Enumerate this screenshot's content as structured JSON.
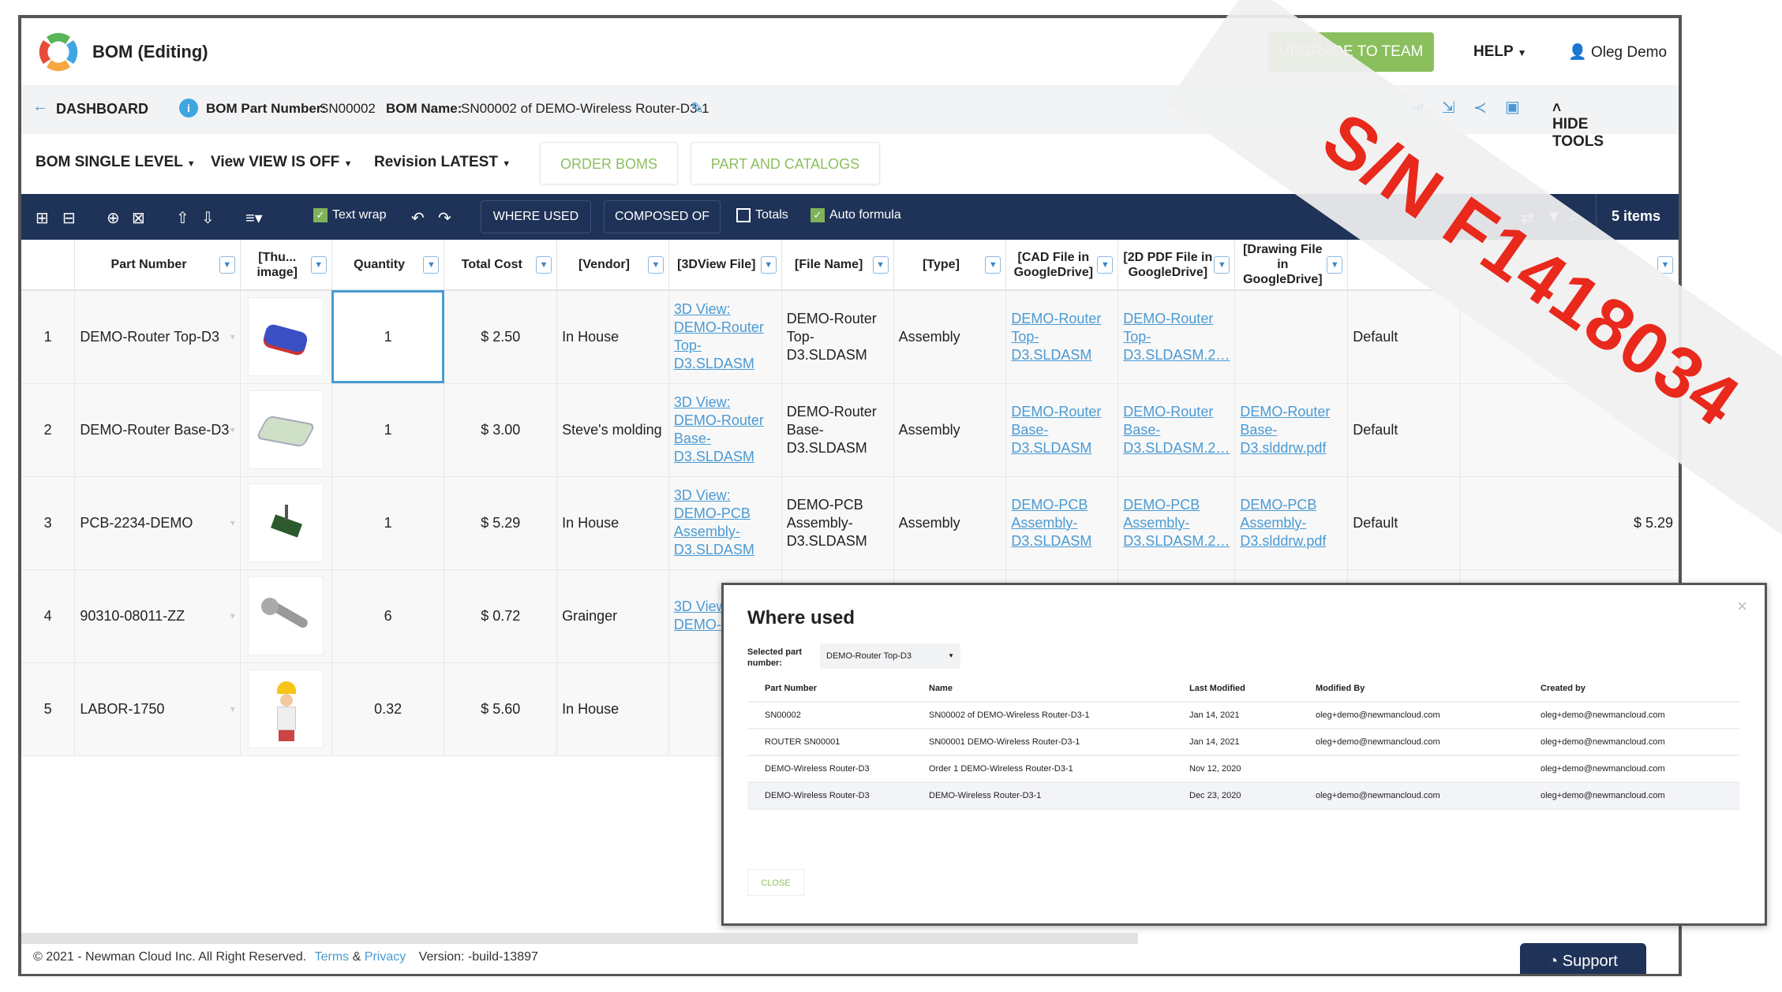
{
  "header": {
    "title": "BOM (Editing)",
    "upgrade": "UPGRADE TO TEAM",
    "help": "HELP",
    "user": "Oleg Demo"
  },
  "breadcrumb": {
    "back": "DASHBOARD",
    "part_label": "BOM Part Number:",
    "part_value": "SN00002",
    "name_label": "BOM Name:",
    "name_value": "SN00002 of DEMO-Wireless Router-D3-1",
    "hide_tools": "HIDE TOOLS"
  },
  "options": {
    "bom": "BOM  SINGLE LEVEL",
    "view": "View  VIEW IS OFF",
    "revision": "Revision  LATEST",
    "order_boms": "ORDER BOMS",
    "part_catalogs": "PART AND CATALOGS"
  },
  "toolbar": {
    "text_wrap": "Text wrap",
    "where_used": "WHERE USED",
    "composed_of": "COMPOSED OF",
    "totals": "Totals",
    "auto_formula": "Auto formula",
    "items": "5 items"
  },
  "table": {
    "headers": [
      "",
      "Part Number",
      "[Thu... image]",
      "Quantity",
      "Total Cost",
      "[Vendor]",
      "[3DView File]",
      "[File Name]",
      "[Type]",
      "[CAD File in GoogleDrive]",
      "[2D PDF File in GoogleDrive]",
      "[Drawing File in GoogleDrive]",
      "",
      ""
    ],
    "rows": [
      [
        "1",
        "DEMO-Router Top-D3",
        "",
        "1",
        "$ 2.50",
        "In House",
        "3D View: DEMO-Router Top-D3.SLDASM",
        "DEMO-Router Top-D3.SLDASM",
        "Assembly",
        "DEMO-Router Top-D3.SLDASM",
        "DEMO-Router Top-D3.SLDASM.2…",
        "",
        "Default",
        ""
      ],
      [
        "2",
        "DEMO-Router Base-D3",
        "",
        "1",
        "$ 3.00",
        "Steve's molding",
        "3D View: DEMO-Router Base-D3.SLDASM",
        "DEMO-Router Base-D3.SLDASM",
        "Assembly",
        "DEMO-Router Base-D3.SLDASM",
        "DEMO-Router Base-D3.SLDASM.2…",
        "DEMO-Router Base-D3.slddrw.pdf",
        "Default",
        ""
      ],
      [
        "3",
        "PCB-2234-DEMO",
        "",
        "1",
        "$ 5.29",
        "In House",
        "3D View: DEMO-PCB Assembly-D3.SLDASM",
        "DEMO-PCB Assembly-D3.SLDASM",
        "Assembly",
        "DEMO-PCB Assembly-D3.SLDASM",
        "DEMO-PCB Assembly-D3.SLDASM.2…",
        "DEMO-PCB Assembly-D3.slddrw.pdf",
        "Default",
        "$ 5.29"
      ],
      [
        "4",
        "90310-08011-ZZ",
        "",
        "6",
        "$ 0.72",
        "Grainger",
        "3D View: DEMO- 08011...",
        "",
        "",
        "",
        "",
        "",
        "",
        ""
      ],
      [
        "5",
        "LABOR-1750",
        "",
        "0.32",
        "$ 5.60",
        "In House",
        "",
        "",
        "",
        "",
        "",
        "",
        "",
        ""
      ]
    ]
  },
  "modal": {
    "title": "Where used",
    "selected_label": "Selected part number:",
    "selected_value": "DEMO-Router Top-D3",
    "headers": [
      "Part Number",
      "Name",
      "Last Modified",
      "Modified By",
      "Created by"
    ],
    "rows": [
      [
        "SN00002",
        "SN00002 of DEMO-Wireless Router-D3-1",
        "Jan 14, 2021",
        "oleg+demo@newmancloud.com",
        "oleg+demo@newmancloud.com"
      ],
      [
        "ROUTER SN00001",
        "SN00001 DEMO-Wireless Router-D3-1",
        "Jan 14, 2021",
        "oleg+demo@newmancloud.com",
        "oleg+demo@newmancloud.com"
      ],
      [
        "DEMO-Wireless Router-D3",
        "Order 1 DEMO-Wireless Router-D3-1",
        "Nov 12, 2020",
        "",
        "oleg+demo@newmancloud.com"
      ],
      [
        "DEMO-Wireless Router-D3",
        "DEMO-Wireless Router-D3-1",
        "Dec 23, 2020",
        "oleg+demo@newmancloud.com",
        "oleg+demo@newmancloud.com"
      ]
    ],
    "close": "CLOSE"
  },
  "footer": {
    "copyright": "© 2021 - Newman Cloud Inc. All Right Reserved.",
    "terms": "Terms",
    "amp": "&",
    "privacy": "Privacy",
    "version": "Version: -build-13897",
    "support": "Support"
  },
  "watermark": "S/N F1418034",
  "colors": {
    "navy": "#1f3257",
    "green": "#8bbf5e",
    "link": "#4a9ad4",
    "watermark": "#e8291c"
  }
}
